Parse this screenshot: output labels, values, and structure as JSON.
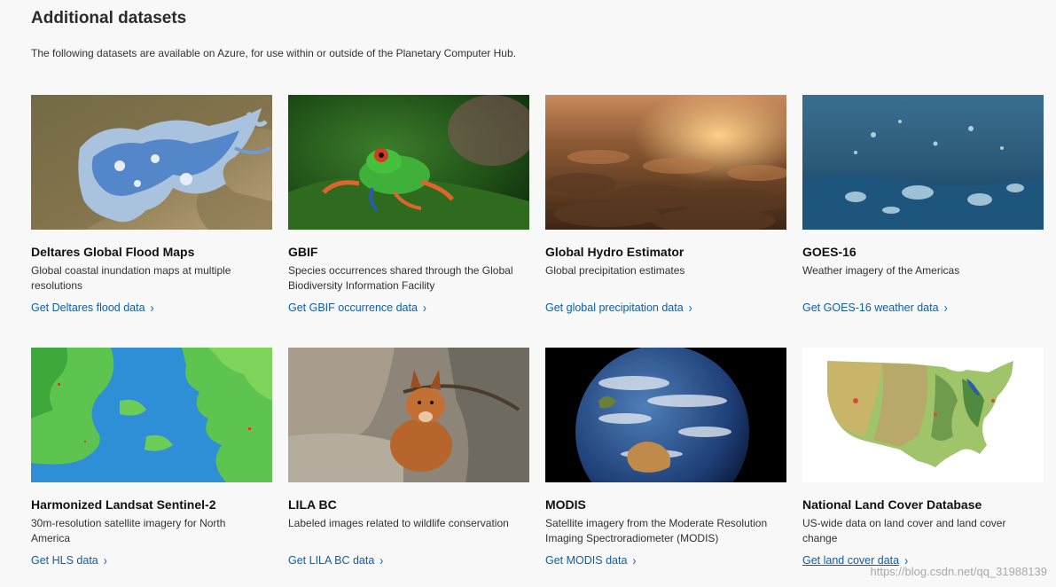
{
  "section": {
    "title": "Additional datasets",
    "intro": "The following datasets are available on Azure, for use within or outside of the Planetary Computer Hub."
  },
  "cards": [
    {
      "name": "Deltares Global Flood Maps",
      "description": "Global coastal inundation maps at multiple resolutions",
      "link": "Get Deltares flood data",
      "image": "flood-map-thumbnail"
    },
    {
      "name": "GBIF",
      "description": "Species occurrences shared through the Global Biodiversity Information Facility",
      "link": "Get GBIF occurrence data",
      "image": "tree-frog-thumbnail"
    },
    {
      "name": "Global Hydro Estimator",
      "description": "Global precipitation estimates",
      "link": "Get global precipitation data",
      "image": "clouds-sunset-thumbnail"
    },
    {
      "name": "GOES-16",
      "description": "Weather imagery of the Americas",
      "link": "Get GOES-16 weather data",
      "image": "rain-water-thumbnail"
    },
    {
      "name": "Harmonized Landsat Sentinel-2",
      "description": "30m-resolution satellite imagery for North America",
      "link": "Get HLS data",
      "image": "landsat-coast-thumbnail"
    },
    {
      "name": "LILA BC",
      "description": "Labeled images related to wildlife conservation",
      "link": "Get LILA BC data",
      "image": "fox-thumbnail"
    },
    {
      "name": "MODIS",
      "description": "Satellite imagery from the Moderate Resolution Imaging Spectroradiometer (MODIS)",
      "link": "Get MODIS data",
      "image": "earth-globe-thumbnail"
    },
    {
      "name": "National Land Cover Database",
      "description": "US-wide data on land cover and land cover change",
      "link": "Get land cover data",
      "image": "us-land-cover-thumbnail"
    }
  ],
  "chevron": "›",
  "watermark": "https://blog.csdn.net/qq_31988139",
  "colors": {
    "link": "#0f5ea8",
    "background": "#f8f8f8"
  }
}
